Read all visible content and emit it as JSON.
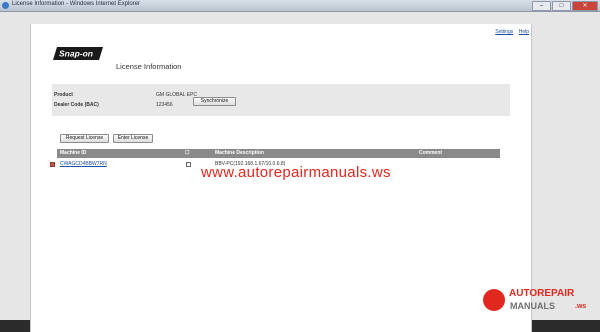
{
  "window": {
    "title": "License Information - Windows Internet Explorer",
    "buttons": {
      "minimize": "–",
      "maximize": "□",
      "close": "✕"
    }
  },
  "toplinks": {
    "settings": "Settings",
    "help": "Help"
  },
  "logo": {
    "text": "Snap-on"
  },
  "page_title": "License Information",
  "info": {
    "product_label": "Product",
    "product_value": "GM GLOBAL EPC",
    "dealer_label": "Dealer Code (BAC)",
    "dealer_value": "123456",
    "sync_button": "Synchronize"
  },
  "actions": {
    "request_license": "Request License",
    "enter_license": "Enter License"
  },
  "table": {
    "columns": {
      "machine_id": "Machine ID",
      "flag": "☐",
      "description": "Machine Description",
      "comment": "Comment"
    },
    "rows": [
      {
        "machine_id": "CWAGCD4BBW7RN",
        "description": "BBV-PC(192.168.1.67/10.0.6.8)",
        "comment": ""
      }
    ]
  },
  "watermark": "www.autorepairmanuals.ws",
  "brand_badge": {
    "line1": "AUTOREPAIR",
    "line2": "MANUALS",
    "suffix": ".ws"
  },
  "colors": {
    "header_gray": "#8a8a8a",
    "link_blue": "#1d4fa6",
    "watermark_red": "#e0281f",
    "info_panel": "#e8e8e8"
  }
}
